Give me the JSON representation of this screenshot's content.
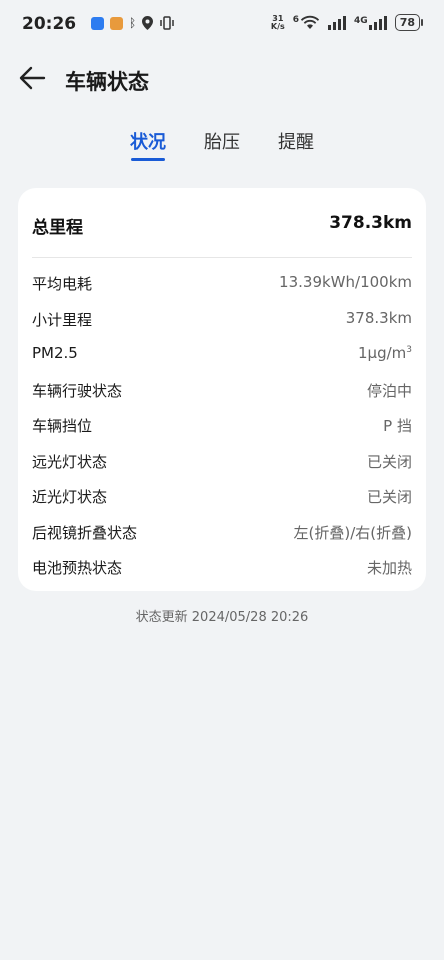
{
  "status_bar": {
    "time": "20:26",
    "net_speed_value": "31",
    "net_speed_unit": "K/s",
    "wifi_badge": "6",
    "cell_type": "4G",
    "battery": "78",
    "icons": [
      "app-badge-blue",
      "app-badge-orange",
      "bluetooth-icon",
      "location-icon",
      "vibrate-icon",
      "wifi-icon",
      "signal-icon"
    ]
  },
  "header": {
    "title": "车辆状态"
  },
  "tabs": [
    {
      "label": "状况",
      "active": true
    },
    {
      "label": "胎压",
      "active": false
    },
    {
      "label": "提醒",
      "active": false
    }
  ],
  "card": {
    "total_label": "总里程",
    "total_value": "378.3km",
    "rows": [
      {
        "label": "平均电耗",
        "value": "13.39kWh/100km"
      },
      {
        "label": "小计里程",
        "value": "378.3km"
      },
      {
        "label": "PM2.5",
        "value": "1μg/m",
        "value_sup": "3"
      },
      {
        "label": "车辆行驶状态",
        "value": "停泊中"
      },
      {
        "label": "车辆挡位",
        "value": "P 挡"
      },
      {
        "label": "远光灯状态",
        "value": "已关闭"
      },
      {
        "label": "近光灯状态",
        "value": "已关闭"
      },
      {
        "label": "后视镜折叠状态",
        "value": "左(折叠)/右(折叠)"
      },
      {
        "label": "电池预热状态",
        "value": "未加热"
      }
    ]
  },
  "update_text": "状态更新 2024/05/28 20:26",
  "colors": {
    "accent": "#1a5bd6",
    "background": "#f1f3f5",
    "card": "#ffffff"
  }
}
